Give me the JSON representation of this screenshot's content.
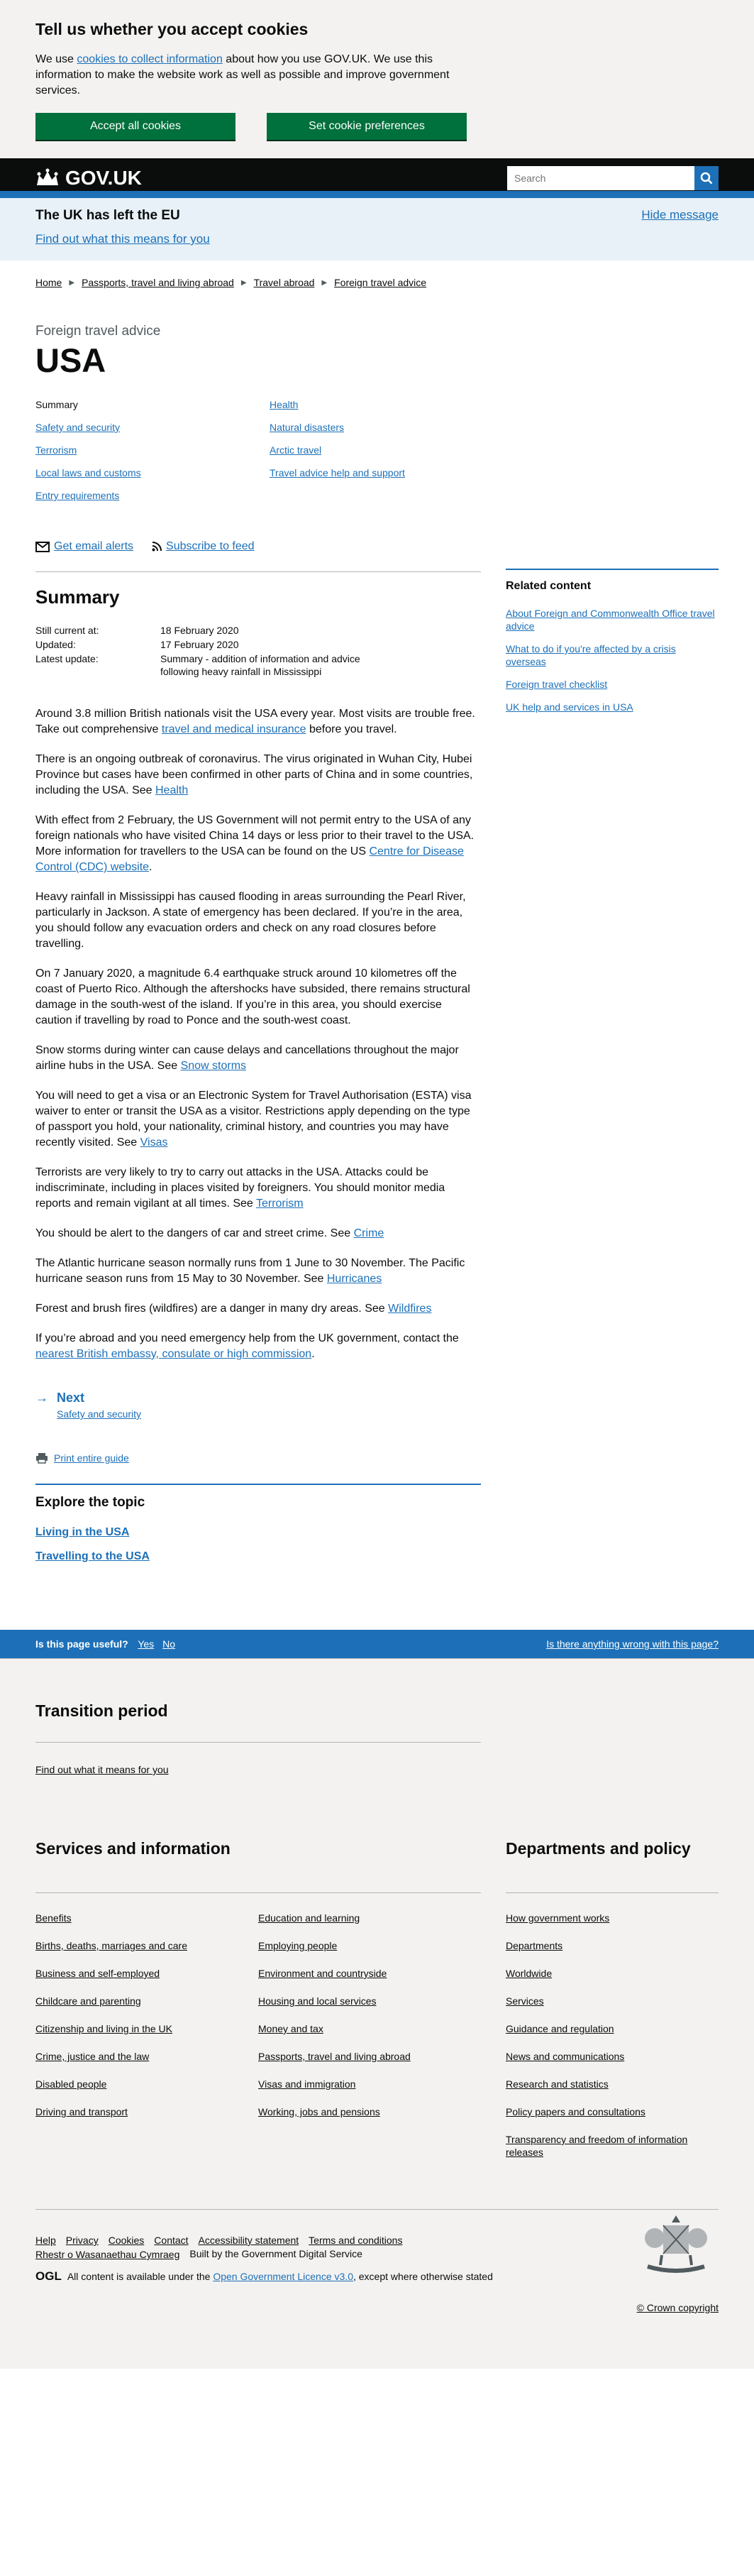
{
  "cookie": {
    "title": "Tell us whether you accept cookies",
    "text_before": "We use ",
    "link": "cookies to collect information",
    "text_after": " about how you use GOV.UK. We use this information to make the website work as well as possible and improve government services.",
    "accept": "Accept all cookies",
    "prefs": "Set cookie preferences"
  },
  "header": {
    "logo": "GOV.UK",
    "search_placeholder": "Search"
  },
  "brexit": {
    "title": "The UK has left the EU",
    "link": "Find out what this means for you",
    "hide": "Hide message"
  },
  "breadcrumbs": [
    "Home",
    "Passports, travel and living abroad",
    "Travel abroad",
    "Foreign travel advice"
  ],
  "page": {
    "caption": "Foreign travel advice",
    "title": "USA"
  },
  "contents": {
    "col1": [
      "Summary",
      "Safety and security",
      "Terrorism",
      "Local laws and customs",
      "Entry requirements"
    ],
    "col2": [
      "Health",
      "Natural disasters",
      "Arctic travel",
      "Travel advice help and support"
    ]
  },
  "subscribe": {
    "email": "Get email alerts",
    "feed": "Subscribe to feed"
  },
  "summary": {
    "title": "Summary",
    "meta": [
      {
        "label": "Still current at:",
        "value": "18 February 2020"
      },
      {
        "label": "Updated:",
        "value": "17 February 2020"
      },
      {
        "label": "Latest update:",
        "value": "Summary - addition of information and advice following heavy rainfall in Mississippi"
      }
    ],
    "p1a": "Around 3.8 million British nationals visit the USA every year. Most visits are trouble free. Take out comprehensive ",
    "p1link": "travel and medical insurance",
    "p1b": " before you travel.",
    "p2a": "There is an ongoing outbreak of coronavirus. The virus originated in Wuhan City, Hubei Province but cases have been confirmed in other parts of China and in some countries, including the USA. See ",
    "p2link": "Health",
    "p3a": "With effect from 2 February, the US Government will not permit entry to the USA of any foreign nationals who have visited China 14 days or less prior to their travel to the USA. More information for travellers to the USA can be found on the US ",
    "p3link": "Centre for Disease Control (CDC) website",
    "p3b": ".",
    "p4": "Heavy rainfall in Mississippi has caused flooding in areas surrounding the Pearl River, particularly in Jackson. A state of emergency has been declared. If you’re in the area, you should follow any evacuation orders and check on any road closures before travelling.",
    "p5": "On 7 January 2020, a magnitude 6.4 earthquake struck around 10 kilometres off the coast of Puerto Rico. Although the aftershocks have subsided, there remains structural damage in the south-west of the island. If you’re in this area, you should exercise caution if travelling by road to Ponce and the south-west coast.",
    "p6a": "Snow storms during winter can cause delays and cancellations throughout the major airline hubs in the USA. See ",
    "p6link": "Snow storms",
    "p7a": "You will need to get a visa or an Electronic System for Travel Authorisation (ESTA) visa waiver to enter or transit the USA as a visitor. Restrictions apply depending on the type of passport you hold, your nationality, criminal history, and countries you may have recently visited. See ",
    "p7link": "Visas",
    "p8a": "Terrorists are very likely to try to carry out attacks in the USA. Attacks could be indiscriminate, including in places visited by foreigners. You should monitor media reports and remain vigilant at all times. See ",
    "p8link": "Terrorism",
    "p9a": "You should be alert to the dangers of car and street crime. See ",
    "p9link": "Crime",
    "p10a": "The Atlantic hurricane season normally runs from 1 June to 30 November. The Pacific hurricane season runs from 15 May to 30 November. See ",
    "p10link": "Hurricanes",
    "p11a": "Forest and brush fires (wildfires) are a danger in many dry areas. See ",
    "p11link": "Wildfires",
    "p12a": "If you’re abroad and you need emergency help from the UK government, contact the ",
    "p12link": "nearest British embassy, consulate or high commission",
    "p12b": "."
  },
  "next": {
    "label": "Next",
    "sub": "Safety and security"
  },
  "print": "Print entire guide",
  "related": {
    "title": "Related content",
    "links": [
      "About Foreign and Commonwealth Office travel advice",
      "What to do if you're affected by a crisis overseas",
      "Foreign travel checklist",
      "UK help and services in USA"
    ]
  },
  "explore": {
    "title": "Explore the topic",
    "links": [
      "Living in the USA",
      "Travelling to the USA"
    ]
  },
  "feedback": {
    "question": "Is this page useful?",
    "yes": "Yes",
    "no": "No",
    "wrong": "Is there anything wrong with this page?"
  },
  "footer": {
    "transition_title": "Transition period",
    "transition_link": "Find out what it means for you",
    "services_title": "Services and information",
    "services_col1": [
      "Benefits",
      "Births, deaths, marriages and care",
      "Business and self-employed",
      "Childcare and parenting",
      "Citizenship and living in the UK",
      "Crime, justice and the law",
      "Disabled people",
      "Driving and transport"
    ],
    "services_col2": [
      "Education and learning",
      "Employing people",
      "Environment and countryside",
      "Housing and local services",
      "Money and tax",
      "Passports, travel and living abroad",
      "Visas and immigration",
      "Working, jobs and pensions"
    ],
    "departments_title": "Departments and policy",
    "departments": [
      "How government works",
      "Departments",
      "Worldwide",
      "Services",
      "Guidance and regulation",
      "News and communications",
      "Research and statistics",
      "Policy papers and consultations",
      "Transparency and freedom of information releases"
    ],
    "meta_links": [
      "Help",
      "Privacy",
      "Cookies",
      "Contact",
      "Accessibility statement",
      "Terms and conditions",
      "Rhestr o Wasanaethau Cymraeg"
    ],
    "built": "Built by the Government Digital Service",
    "ogl_mark": "OGL",
    "licence_before": "All content is available under the ",
    "licence_link": "Open Government Licence v3.0",
    "licence_after": ", except where otherwise stated",
    "copyright": "© Crown copyright"
  }
}
